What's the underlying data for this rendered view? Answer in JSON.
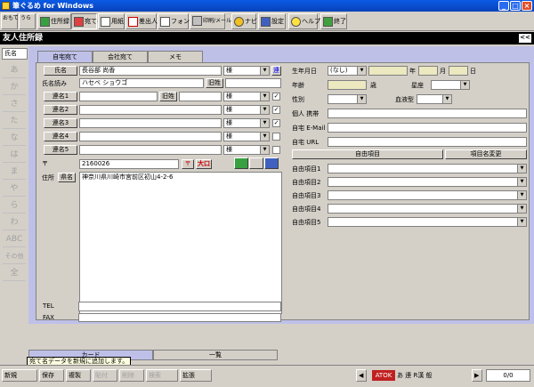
{
  "window": {
    "title": "筆ぐるめ for Windows"
  },
  "toolbar": [
    "おもて",
    "うら",
    "住所録",
    "宛て名",
    "用紙",
    "差出人",
    "フォント",
    "印刷/メール",
    "ナビ",
    "設定",
    "ヘルプ",
    "終了"
  ],
  "header": {
    "title": "友人住所録",
    "collapse": "<<"
  },
  "left_filter": {
    "value": "氏名",
    "kana": [
      "あ",
      "か",
      "さ",
      "た",
      "な",
      "は",
      "ま",
      "や",
      "ら",
      "わ",
      "ABC",
      "その他",
      "全"
    ]
  },
  "tabs": [
    "自宅宛て",
    "会社宛て",
    "メモ"
  ],
  "form": {
    "name_btn": "氏名",
    "name_value": "長谷部 尚香",
    "honorific": "様",
    "honorific_flag": "連",
    "reading_label": "氏名読み",
    "reading_value": "ハセベ ショウゴ",
    "old_name": "旧姓",
    "joint_names": [
      {
        "label": "連名1",
        "old": "旧姓",
        "hon": "様",
        "checked": true
      },
      {
        "label": "連名2",
        "hon": "様",
        "checked": true
      },
      {
        "label": "連名3",
        "hon": "様",
        "checked": true
      },
      {
        "label": "連名4",
        "hon": "様",
        "checked": false
      },
      {
        "label": "連名5",
        "hon": "様",
        "checked": false
      }
    ],
    "postal_label": "〒",
    "postal_value": "2160026",
    "postal_btn": "〒",
    "postal_btn2": "大口",
    "address_label": "住所",
    "address_btn": "県名",
    "address_value": "神奈川県川崎市宮前区初山4-2-6",
    "tel_label": "TEL",
    "fax_label": "FAX",
    "birthday_label": "生年月日",
    "birthday_era": "(なし)",
    "year": "年",
    "month": "月",
    "day": "日",
    "age_label": "年齢",
    "age_unit": "歳",
    "zodiac": "星座",
    "gender_label": "性別",
    "blood_label": "血液型",
    "mobile_label": "個人 携帯",
    "email_label": "自宅 E-Mail",
    "url_label": "自宅 URL",
    "free_header": "自由項目",
    "free_change": "項目名変更",
    "free_items": [
      "自由項目1",
      "自由項目2",
      "自由項目3",
      "自由項目4",
      "自由項目5"
    ]
  },
  "bottom_tabs": {
    "card": "カード",
    "list": "一覧"
  },
  "tooltip": "宛て名データを新規に追加します。",
  "status": {
    "new": "新規",
    "save": "保存",
    "copy": "複製",
    "paste": "貼付",
    "delete": "削除",
    "search": "検索",
    "zoom": "拡張",
    "ime": "ATOK",
    "ime_modes": "あ 連 R漢 般",
    "count": "0/0"
  }
}
